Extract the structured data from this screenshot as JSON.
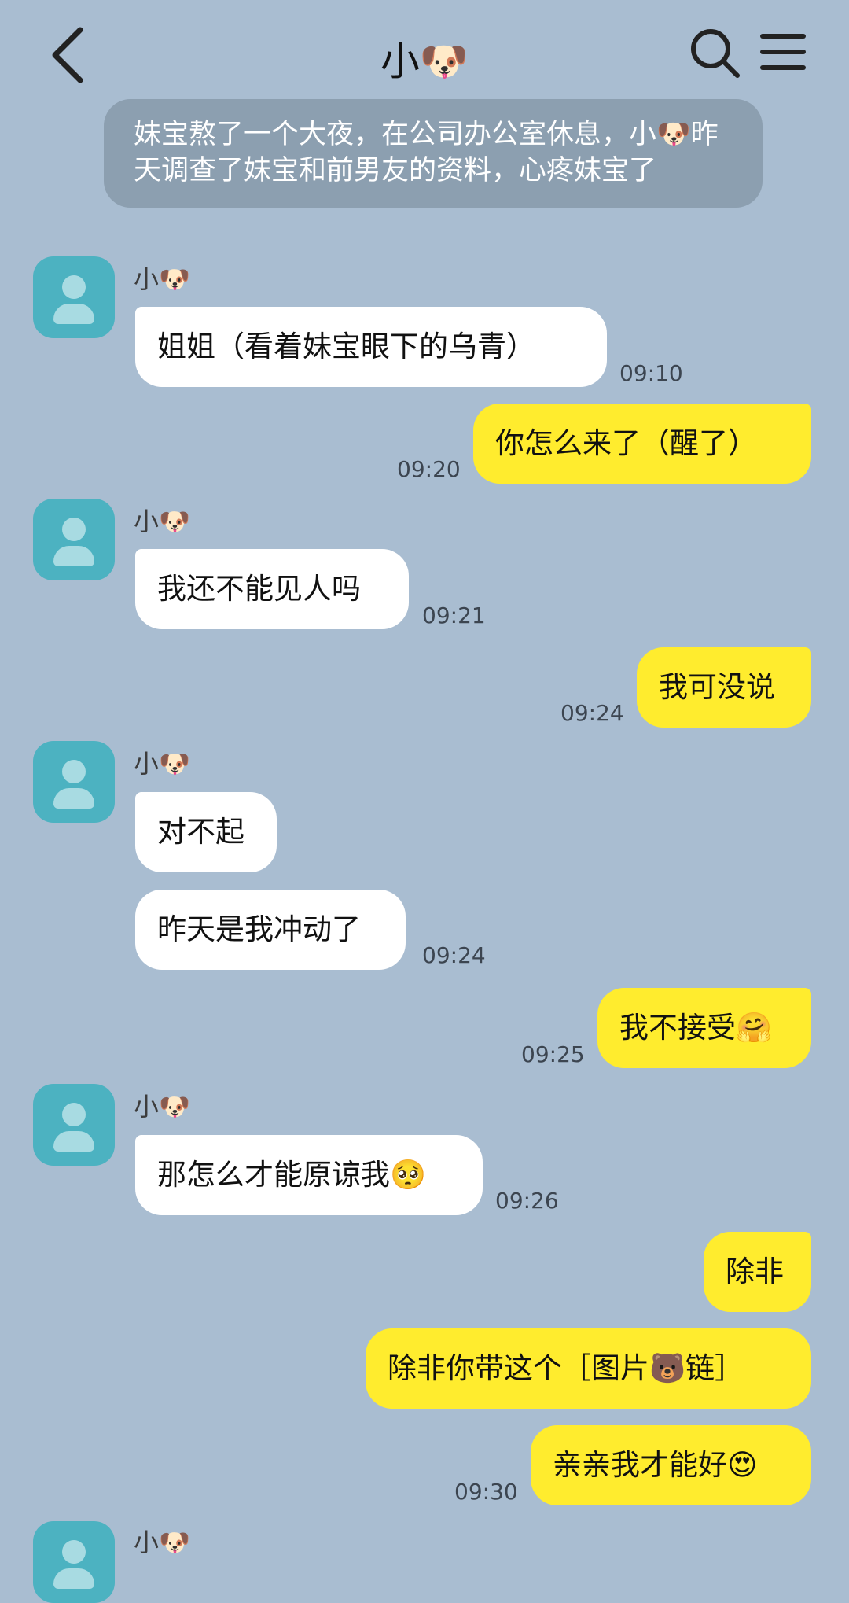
{
  "header": {
    "title": "小🐶",
    "back_icon": "chevron-left-icon",
    "search_icon": "search-icon",
    "menu_icon": "hamburger-menu-icon"
  },
  "narration": "妹宝熬了一个大夜，在公司办公室休息，小🐶昨天调查了妹宝和前男友的资料，心疼妹宝了",
  "colors": {
    "background": "#a9bdd1",
    "incoming_bubble": "#ffffff",
    "outgoing_bubble": "#ffec2e",
    "avatar": "#4cb2c1",
    "narration": "#8c9fb0"
  },
  "messages": [
    {
      "sender": "小🐶",
      "text": "姐姐（看着妹宝眼下的乌青）",
      "time": "09:10"
    },
    {
      "text": "你怎么来了（醒了）",
      "time": "09:20"
    },
    {
      "sender": "小🐶",
      "text": "我还不能见人吗",
      "time": "09:21"
    },
    {
      "text": "我可没说",
      "time": "09:24"
    },
    {
      "sender": "小🐶",
      "text": "对不起"
    },
    {
      "text": "昨天是我冲动了",
      "time": "09:24"
    },
    {
      "text": "我不接受🤗",
      "time": "09:25"
    },
    {
      "sender": "小🐶",
      "text": "那怎么才能原谅我🥺",
      "time": "09:26"
    },
    {
      "text": "除非"
    },
    {
      "text": "除非你带这个［图片🐻链］"
    },
    {
      "text": "亲亲我才能好😍",
      "time": "09:30"
    },
    {
      "sender": "小🐶"
    }
  ]
}
